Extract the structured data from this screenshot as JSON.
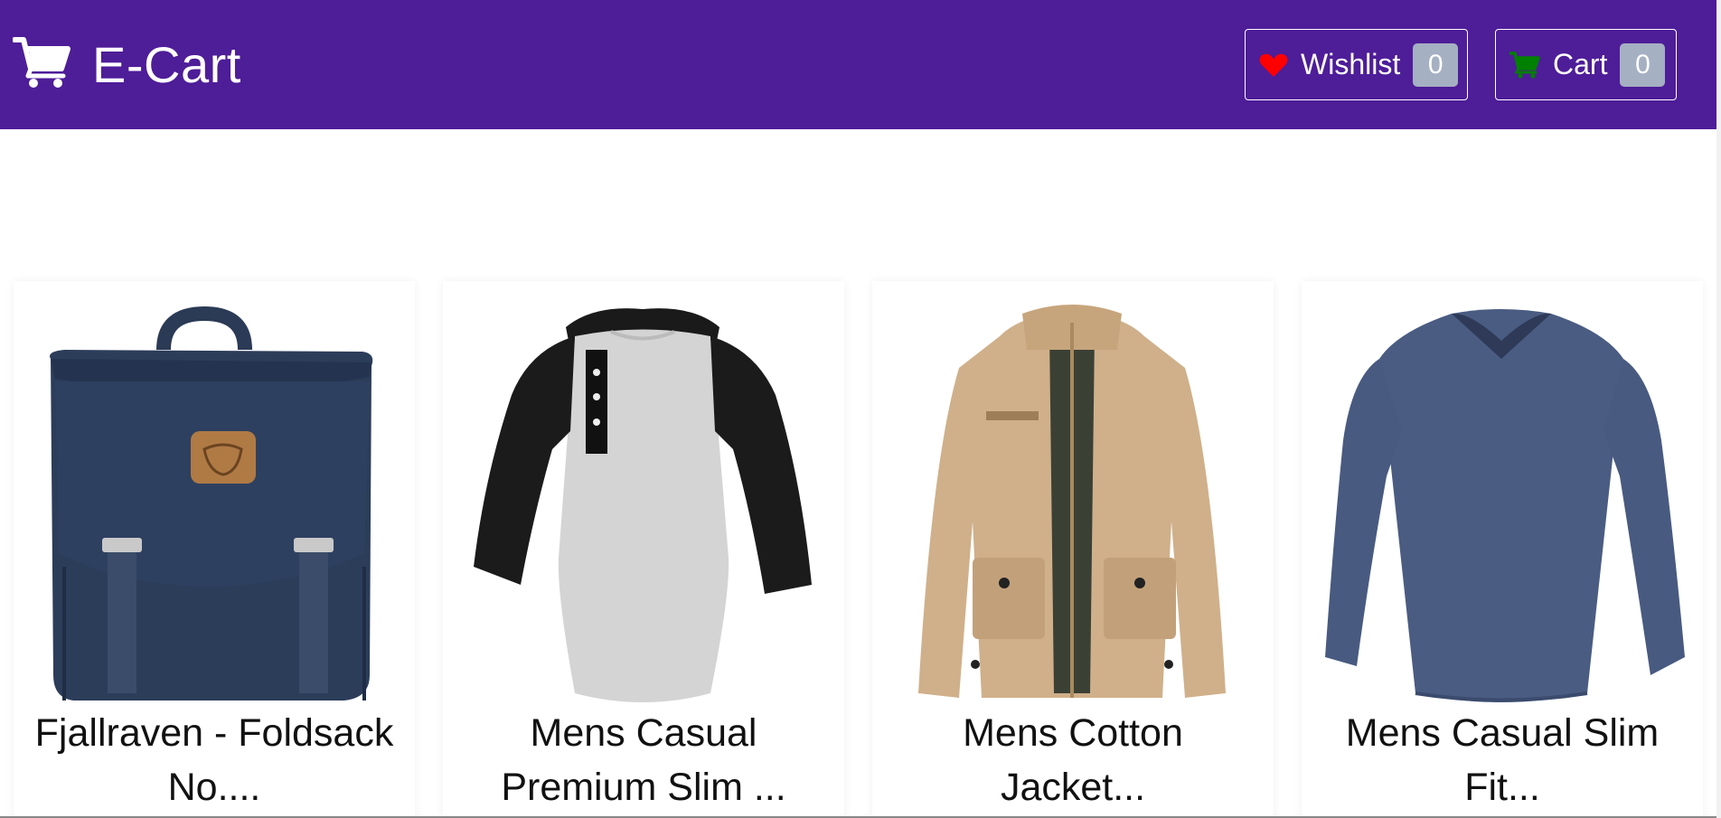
{
  "brand": {
    "title": "E-Cart",
    "icon": "cart-icon"
  },
  "nav": {
    "wishlist": {
      "label": "Wishlist",
      "count": "0",
      "icon": "heart-icon",
      "icon_color": "#ff0000"
    },
    "cart": {
      "label": "Cart",
      "count": "0",
      "icon": "cart-icon",
      "icon_color": "#008000"
    }
  },
  "colors": {
    "navbar": "#4e1d98",
    "badge": "#a5b0c2"
  },
  "products": [
    {
      "title": "Fjallraven - Foldsack No....",
      "image": "backpack-image"
    },
    {
      "title": "Mens Casual Premium Slim ...",
      "image": "raglan-tshirt-image"
    },
    {
      "title": "Mens Cotton Jacket...",
      "image": "cotton-jacket-image"
    },
    {
      "title": "Mens Casual Slim Fit...",
      "image": "longsleeve-tshirt-image"
    }
  ]
}
